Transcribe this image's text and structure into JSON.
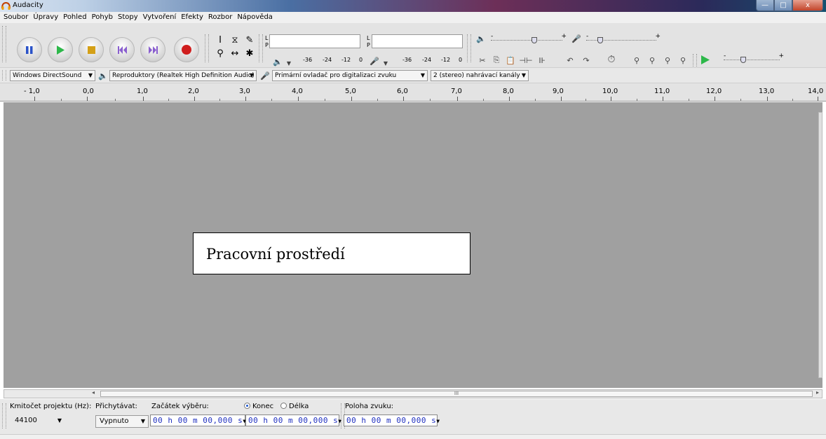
{
  "window": {
    "title": "Audacity",
    "minimize_glyph": "—",
    "maximize_glyph": "□",
    "close_glyph": "x"
  },
  "menu": [
    "Soubor",
    "Úpravy",
    "Pohled",
    "Pohyb",
    "Stopy",
    "Vytvoření",
    "Efekty",
    "Rozbor",
    "Nápověda"
  ],
  "meters": {
    "left_channel": "L",
    "right_channel": "P",
    "ticks": [
      "-36",
      "-24",
      "-12",
      "0"
    ]
  },
  "devices": {
    "host": "Windows DirectSound",
    "output": "Reproduktory (Realtek High Definition Audio)",
    "input": "Primární ovladač pro digitalizaci zvuku",
    "channels": "2 (stereo) nahrávací kanály"
  },
  "ruler": [
    "- 1,0",
    "0,0",
    "1,0",
    "2,0",
    "3,0",
    "4,0",
    "5,0",
    "6,0",
    "7,0",
    "8,0",
    "9,0",
    "10,0",
    "11,0",
    "12,0",
    "13,0",
    "14,0"
  ],
  "workspace": {
    "label": "Pracovní prostředí"
  },
  "scrollbar": {
    "grip": "III"
  },
  "selection": {
    "rate_label": "Kmitočet projektu (Hz):",
    "rate_value": "44100",
    "snap_label": "Přichytávat:",
    "snap_value": "Vypnuto",
    "start_label": "Začátek výběru:",
    "end_label": "Konec",
    "length_label": "Délka",
    "position_label": "Poloha zvuku:",
    "time_start": "00 h 00 m 00,000 s",
    "time_end": "00 h 00 m 00,000 s",
    "time_position": "00 h 00 m 00,000 s"
  },
  "colors": {
    "workspace": "#a0a0a0",
    "play": "#2db84a",
    "record": "#d01e1e",
    "pause": "#2a52c8",
    "time_digits": "#2030c0"
  }
}
